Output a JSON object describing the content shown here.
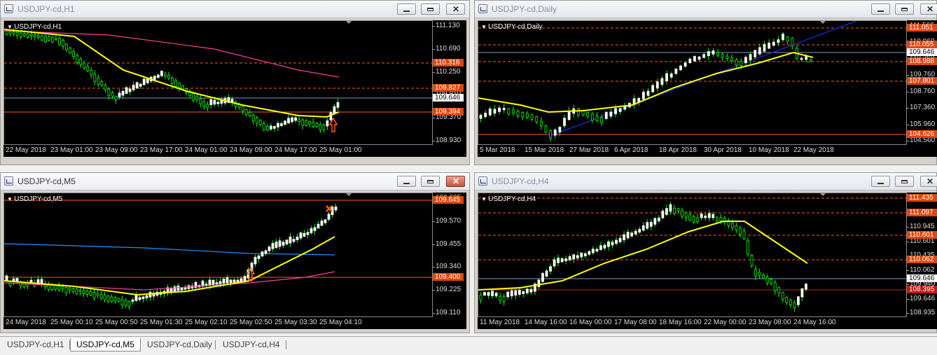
{
  "windows": [
    {
      "id": "w1",
      "title": "USDJPY-cd,H1",
      "label": "USDJPY-cd,H1",
      "active": false,
      "price_labels": [
        "111.130",
        "110.690",
        "110.250",
        "109.810",
        "109.370",
        "108.930"
      ],
      "hlines": [
        {
          "price": "110.316",
          "kind": "sr",
          "style": "dash"
        },
        {
          "price": "109.827",
          "kind": "sr",
          "style": "dash"
        },
        {
          "price": "109.646",
          "kind": "cur",
          "style": "solid"
        },
        {
          "price": "109.394",
          "kind": "sr",
          "style": "solid"
        }
      ],
      "time_labels": [
        "22 May 2018",
        "23 May 01:00",
        "23 May 09:00",
        "23 May 17:00",
        "24 May 01:00",
        "24 May 09:00",
        "24 May 17:00",
        "25 May 01:00"
      ]
    },
    {
      "id": "w2",
      "title": "USDJPY-cd,Daily",
      "label": "USDJPY-cd,Daily",
      "active": false,
      "price_labels": [
        "111.560",
        "110.960",
        "110.360",
        "109.760",
        "108.760",
        "107.360",
        "105.960",
        "104.560"
      ],
      "hlines": [
        {
          "price": "111.051",
          "kind": "sr",
          "style": "dash"
        },
        {
          "price": "110.055",
          "kind": "sr",
          "style": "dash"
        },
        {
          "price": "109.646",
          "kind": "cur",
          "style": "solid"
        },
        {
          "price": "108.988",
          "kind": "sr",
          "style": "dash"
        },
        {
          "price": "107.801",
          "kind": "sr",
          "style": "dash"
        },
        {
          "price": "104.626",
          "kind": "sr",
          "style": "solid"
        }
      ],
      "time_labels": [
        "5 Mar 2018",
        "15 Mar 2018",
        "27 Mar 2018",
        "6 Apr 2018",
        "18 Apr 2018",
        "30 Apr 2018",
        "10 May 2018",
        "22 May 2018"
      ]
    },
    {
      "id": "w3",
      "title": "USDJPY-cd,M5",
      "label": "USDJPY-cd,M5",
      "active": true,
      "price_labels": [
        "109.685",
        "109.570",
        "109.455",
        "109.340",
        "109.225",
        "109.110"
      ],
      "hlines": [
        {
          "price": "109.645",
          "kind": "sr",
          "style": "solid"
        },
        {
          "price": "109.400",
          "kind": "sr",
          "style": "solid"
        }
      ],
      "time_labels": [
        "24 May 2018",
        "25 May 00:10",
        "25 May 00:50",
        "25 May 01:30",
        "25 May 02:10",
        "25 May 02:50",
        "25 May 03:30",
        "25 May 04:10"
      ]
    },
    {
      "id": "w4",
      "title": "USDJPY-cd,H4",
      "label": "USDJPY-cd,H4",
      "active": false,
      "price_labels": [
        "111.435",
        "111.097",
        "110.945",
        "110.601",
        "110.435",
        "110.062",
        "109.940",
        "109.646",
        "108.935"
      ],
      "hlines": [
        {
          "price": "111.435",
          "kind": "sr",
          "style": "dash"
        },
        {
          "price": "111.097",
          "kind": "sr",
          "style": "dash"
        },
        {
          "price": "110.601",
          "kind": "sr",
          "style": "dash"
        },
        {
          "price": "110.062",
          "kind": "sr",
          "style": "dash"
        },
        {
          "price": "109.646",
          "kind": "cur",
          "style": "solid"
        },
        {
          "price": "108.395",
          "kind": "red",
          "style": "solid"
        }
      ],
      "time_labels": [
        "11 May 2018",
        "14 May 16:00",
        "16 May 00:00",
        "17 May 08:00",
        "18 May 16:00",
        "22 May 00:00",
        "23 May 08:00",
        "24 May 16:00"
      ]
    }
  ],
  "tabs": [
    "USDJPY-cd,H1",
    "USDJPY-cd,M5",
    "USDJPY-cd,Daily",
    "USDJPY-cd,H4"
  ],
  "selected_tab": 1,
  "colors": {
    "bull": "#ffffff",
    "bear": "#00ff00",
    "ma_fast": "#ffff00",
    "ma_slow": "#ff3c9e",
    "ma_blue": "#1e90ff",
    "sr": "#ff5a1e",
    "trend": "#1428c8"
  }
}
